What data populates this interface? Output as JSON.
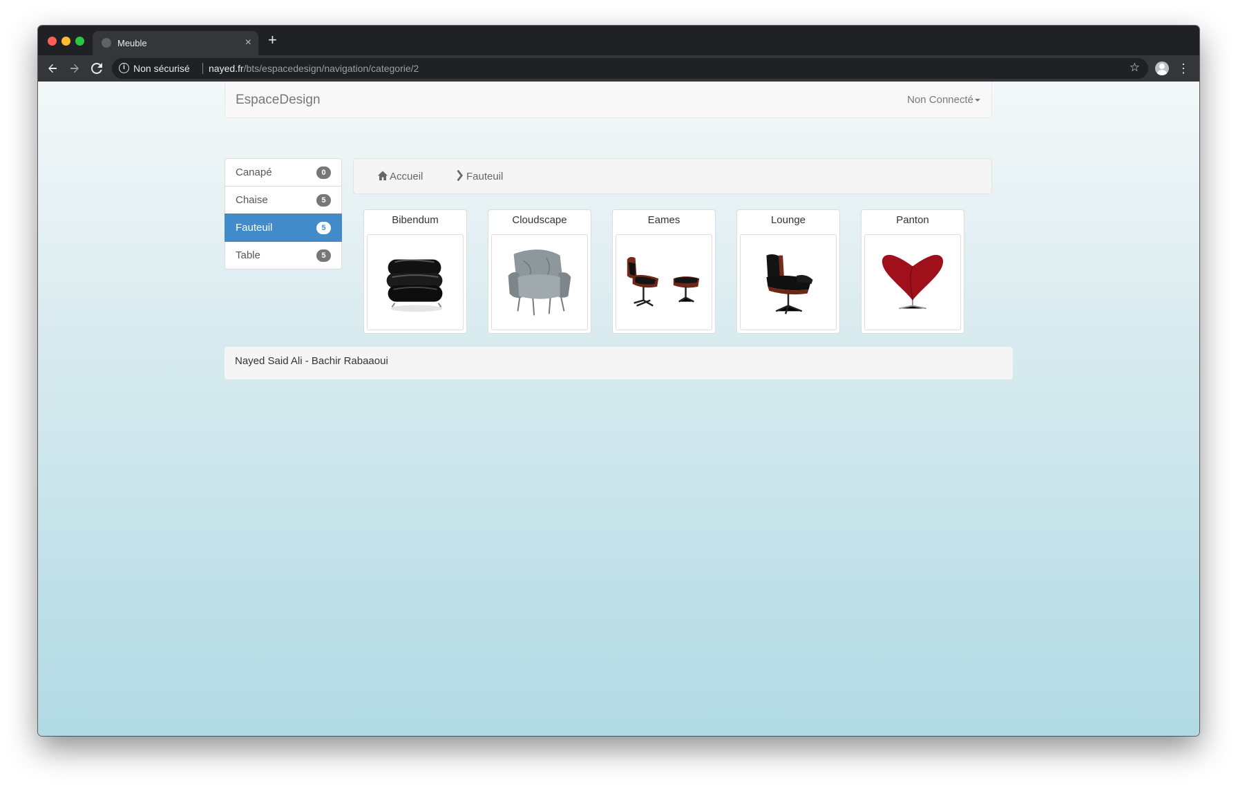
{
  "browser": {
    "tab_title": "Meuble",
    "tab_close": "×",
    "new_tab": "+",
    "security_label": "Non sécurisé",
    "url_host": "nayed.fr",
    "url_path": "/bts/espacedesign/navigation/categorie/2",
    "icons": {
      "back": "arrow-left-icon",
      "forward": "arrow-right-icon",
      "reload": "reload-icon",
      "info": "info-icon",
      "star": "star-icon",
      "profile": "profile-icon",
      "menu": "more-vert-icon"
    }
  },
  "navbar": {
    "brand": "EspaceDesign",
    "user_menu": "Non Connecté"
  },
  "categories": [
    {
      "label": "Canapé",
      "count": "0",
      "active": false
    },
    {
      "label": "Chaise",
      "count": "5",
      "active": false
    },
    {
      "label": "Fauteuil",
      "count": "5",
      "active": true
    },
    {
      "label": "Table",
      "count": "5",
      "active": false
    }
  ],
  "breadcrumb": {
    "home": "Accueil",
    "current": "Fauteuil"
  },
  "products": [
    {
      "name": "Bibendum",
      "image": "black-round-armchair"
    },
    {
      "name": "Cloudscape",
      "image": "grey-fabric-armchair"
    },
    {
      "name": "Eames",
      "image": "lounge-chair-with-ottoman"
    },
    {
      "name": "Lounge",
      "image": "lounge-chair"
    },
    {
      "name": "Panton",
      "image": "red-heart-chair"
    }
  ],
  "footer": {
    "text": "Nayed Said Ali - Bachir Rabaaoui"
  },
  "colors": {
    "active_blue": "#428bca",
    "badge_grey": "#777777",
    "page_gradient_bottom": "#b1dae4"
  }
}
